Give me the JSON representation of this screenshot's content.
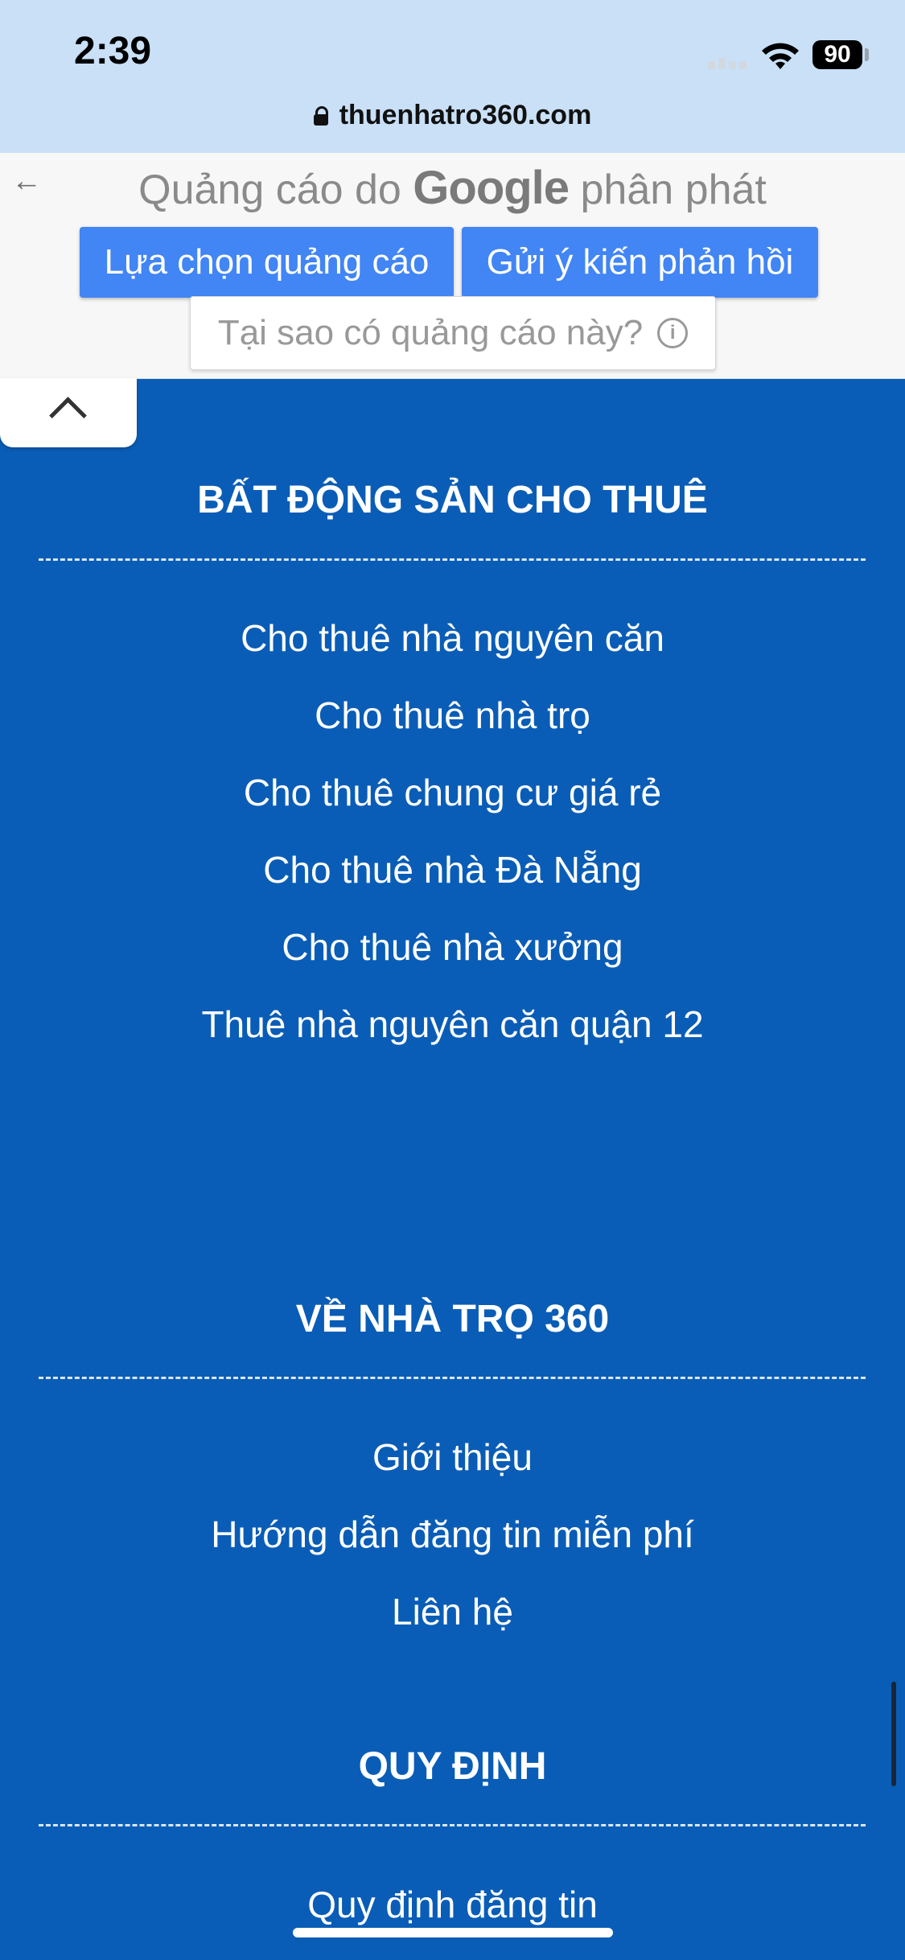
{
  "status": {
    "time": "2:39",
    "battery": "90"
  },
  "browser": {
    "url": "thuenhatro360.com"
  },
  "ad": {
    "title_prefix": "Quảng cáo do",
    "brand": "Google",
    "title_suffix": "phân phát",
    "choices_button": "Lựa chọn quảng cáo",
    "feedback_button": "Gửi ý kiến phản hồi",
    "why_label": "Tại sao có quảng cáo này?"
  },
  "footer": {
    "rental": {
      "title": "BẤT ĐỘNG SẢN CHO THUÊ",
      "links": [
        "Cho thuê nhà nguyên căn",
        "Cho thuê nhà trọ",
        "Cho thuê chung cư giá rẻ",
        "Cho thuê nhà Đà Nẵng",
        "Cho thuê nhà xưởng",
        "Thuê nhà nguyên căn quận 12"
      ]
    },
    "about": {
      "title": "VỀ NHÀ TRỌ 360",
      "links": [
        "Giới thiệu",
        "Hướng dẫn đăng tin miễn phí",
        "Liên hệ"
      ]
    },
    "rules": {
      "title": "QUY ĐỊNH",
      "links": [
        "Quy định đăng tin"
      ]
    }
  }
}
